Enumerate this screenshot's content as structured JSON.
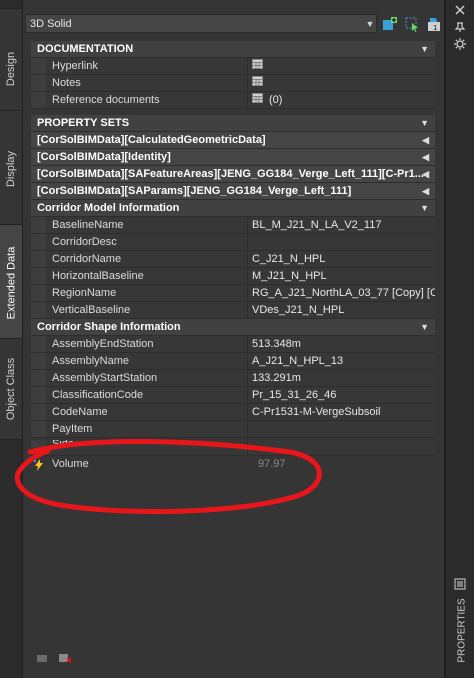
{
  "side_tabs": [
    "Design",
    "Display",
    "Extended Data",
    "Object Class"
  ],
  "object_type": "3D Solid",
  "right_title": "PROPERTIES",
  "sections": {
    "documentation": {
      "title": "DOCUMENTATION",
      "rows": [
        {
          "name": "Hyperlink",
          "value": ""
        },
        {
          "name": "Notes",
          "value": ""
        },
        {
          "name": "Reference documents",
          "value": "(0)"
        }
      ]
    },
    "property_sets": {
      "title": "PROPERTY SETS",
      "groups": [
        "[CorSolBIMData][CalculatedGeometricData]",
        "[CorSolBIMData][Identity]",
        "[CorSolBIMData][SAFeatureAreas][JENG_GG184_Verge_Left_111][C-Pr1...",
        "[CorSolBIMData][SAParams][JENG_GG184_Verge_Left_111]"
      ]
    },
    "corridor_model": {
      "title": "Corridor Model Information",
      "rows": [
        {
          "name": "BaselineName",
          "value": "BL_M_J21_N_LA_V2_117"
        },
        {
          "name": "CorridorDesc",
          "value": ""
        },
        {
          "name": "CorridorName",
          "value": "C_J21_N_HPL"
        },
        {
          "name": "HorizontalBaseline",
          "value": "M_J21_N_HPL"
        },
        {
          "name": "RegionName",
          "value": "RG_A_J21_NorthLA_03_77 [Copy] [C..."
        },
        {
          "name": "VerticalBaseline",
          "value": "VDes_J21_N_HPL"
        }
      ]
    },
    "corridor_shape": {
      "title": "Corridor Shape Information",
      "rows": [
        {
          "name": "AssemblyEndStation",
          "value": "513.348m"
        },
        {
          "name": "AssemblyName",
          "value": "A_J21_N_HPL_13"
        },
        {
          "name": "AssemblyStartStation",
          "value": "133.291m"
        },
        {
          "name": "ClassificationCode",
          "value": "Pr_15_31_26_46"
        },
        {
          "name": "CodeName",
          "value": "C-Pr1531-M-VergeSubsoil"
        },
        {
          "name": "PayItem",
          "value": ""
        },
        {
          "name": "Side",
          "value": ""
        }
      ]
    },
    "volume": {
      "name": "Volume",
      "value": "97.97"
    }
  },
  "colors": {
    "annotation_red": "#e8151b",
    "panel": "#353535",
    "header": "#414141"
  }
}
